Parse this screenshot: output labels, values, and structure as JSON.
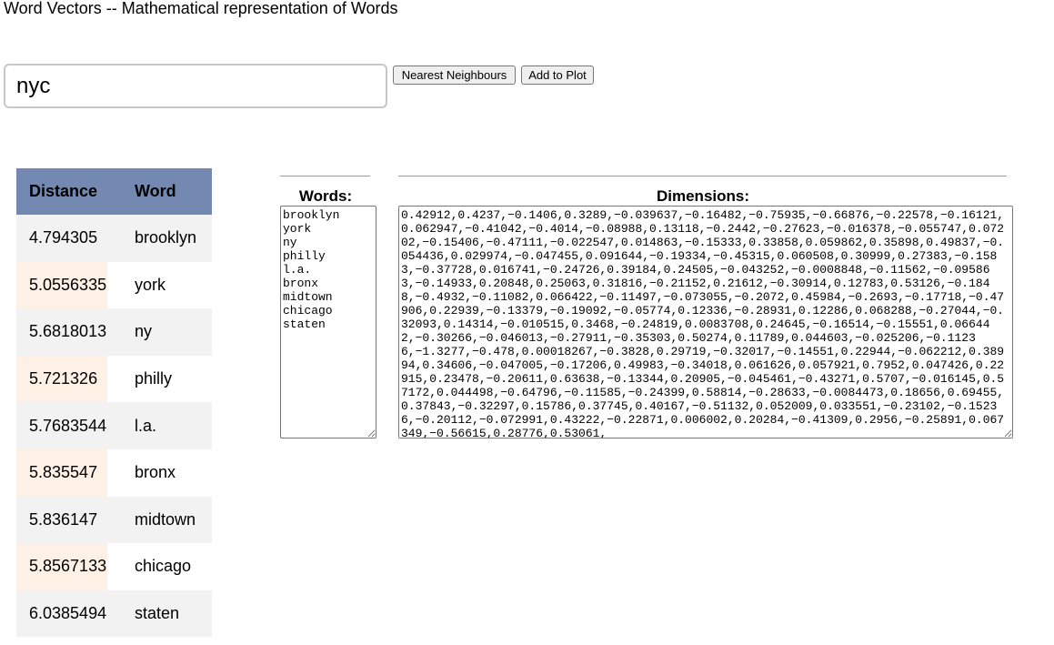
{
  "page": {
    "title": "Word Vectors -- Mathematical representation of Words"
  },
  "search": {
    "value": "nyc",
    "nearest_button": "Nearest Neighbours",
    "add_button": "Add to Plot"
  },
  "results": {
    "headers": {
      "distance": "Distance",
      "word": "Word"
    },
    "rows": [
      {
        "distance": "4.794305",
        "word": "brooklyn"
      },
      {
        "distance": "5.0556335",
        "word": "york"
      },
      {
        "distance": "5.6818013",
        "word": "ny"
      },
      {
        "distance": "5.721326",
        "word": "philly"
      },
      {
        "distance": "5.7683544",
        "word": "l.a."
      },
      {
        "distance": "5.835547",
        "word": "bronx"
      },
      {
        "distance": "5.836147",
        "word": "midtown"
      },
      {
        "distance": "5.8567133",
        "word": "chicago"
      },
      {
        "distance": "6.0385494",
        "word": "staten"
      }
    ]
  },
  "words_panel": {
    "label": "Words:",
    "content": "brooklyn\nyork\nny\nphilly\nl.a.\nbronx\nmidtown\nchicago\nstaten"
  },
  "dims_panel": {
    "label": "Dimensions:",
    "content": "0.42912,0.4237,−0.1406,0.3289,−0.039637,−0.16482,−0.75935,−0.66876,−0.22578,−0.16121,0.062947,−0.41042,−0.4014,−0.08988,0.13118,−0.2442,−0.27623,−0.016378,−0.055747,0.07202,−0.15406,−0.47111,−0.022547,0.014863,−0.15333,0.33858,0.059862,0.35898,0.49837,−0.054436,0.029974,−0.047455,0.091644,−0.19334,−0.45315,0.060508,0.30999,0.27383,−0.1583,−0.37728,0.016741,−0.24726,0.39184,0.24505,−0.043252,−0.0008848,−0.11562,−0.095863,−0.14933,0.20848,0.25063,0.31816,−0.21152,0.21612,−0.30914,0.12783,0.53126,−0.1848,−0.4932,−0.11082,0.066422,−0.11497,−0.073055,−0.2072,0.45984,−0.2693,−0.17718,−0.47906,0.22939,−0.13379,−0.19092,−0.05774,0.12336,−0.28931,0.12286,0.068288,−0.27044,−0.32093,0.14314,−0.010515,0.3468,−0.24819,0.0083708,0.24645,−0.16514,−0.15551,0.066442,−0.30266,−0.046013,−0.27911,−0.35303,0.50274,0.11789,0.044603,−0.025206,−0.11236,−1.3277,−0.478,0.00018267,−0.3828,0.29719,−0.32017,−0.14551,0.22944,−0.062212,0.38994,0.34606,−0.047005,−0.17206,0.49983,−0.34018,0.061626,0.057921,0.7952,0.047426,0.22915,0.23478,−0.20611,0.63638,−0.13344,0.20905,−0.045461,−0.43271,0.5707,−0.016145,0.57172,0.044498,−0.64796,−0.11585,−0.24399,0.58814,−0.28633,−0.0084473,0.18656,0.69455,0.37843,−0.32297,0.15786,0.37745,0.40167,−0.51132,0.052009,0.033551,−0.23102,−0.15236,−0.20112,−0.072991,0.43222,−0.22871,0.006002,0.20284,−0.41309,0.2956,−0.25891,0.067349,−0.56615,0.28776,0.53061,"
  }
}
